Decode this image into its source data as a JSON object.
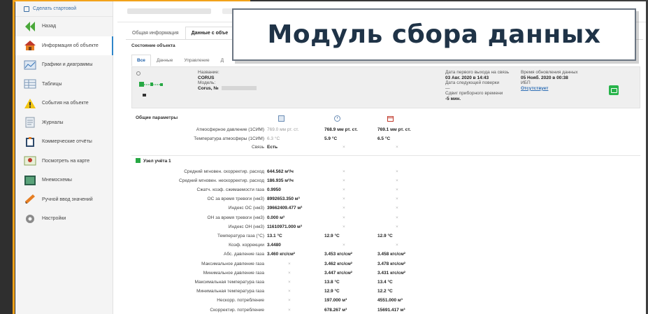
{
  "overlay_title": "Модуль сбора данных",
  "sidebar": {
    "top_link": "Сделать стартовой",
    "items": [
      {
        "label": "Назад",
        "icon": "back-arrow-icon"
      },
      {
        "label": "Информация об объекте",
        "icon": "house-icon"
      },
      {
        "label": "Графики и диаграммы",
        "icon": "chart-icon"
      },
      {
        "label": "Таблицы",
        "icon": "table-icon"
      },
      {
        "label": "События на объекте",
        "icon": "warning-icon"
      },
      {
        "label": "Журналы",
        "icon": "journal-icon"
      },
      {
        "label": "Коммерческие отчёты",
        "icon": "clipboard-icon"
      },
      {
        "label": "Посмотреть на карте",
        "icon": "map-icon"
      },
      {
        "label": "Мнемосхемы",
        "icon": "mnemo-icon"
      },
      {
        "label": "Ручной ввод значений",
        "icon": "pencil-icon"
      },
      {
        "label": "Настройки",
        "icon": "gear-icon"
      }
    ]
  },
  "tabs": [
    "Общая информация",
    "Данные с объе"
  ],
  "section_title": "Состояние объекта",
  "subtabs": [
    "Все",
    "Данные",
    "Управление",
    "Д"
  ],
  "info": {
    "name_label": "Название:",
    "name_value": "CORUS",
    "model_label": "Модель:",
    "model_value": "Corus, №",
    "first_exit_label": "Дата первого выхода на связь",
    "first_exit_value": "03 Авг. 2020 в 14:43",
    "next_check_label": "Дата следующей поверки",
    "next_check_value": "—",
    "time_shift_label": "Сдвиг приборного времени",
    "time_shift_value": "-5 мин.",
    "update_label": "Время обновления данных",
    "update_value": "05 Нояб. 2020 в 00:38",
    "ibp_label": "ИБП",
    "ibp_value": "Отсутствует"
  },
  "common_params": {
    "title": "Общие параметры",
    "rows": [
      {
        "label": "Атмосферное давление (1СИМ)",
        "v1": "769.0 мм рт. ст.",
        "v2": "768.9 мм рт. ст.",
        "v3": "769.1 мм рт. ст.",
        "v1_grey": true
      },
      {
        "label": "Температура атмосферы (1СИМ)",
        "v1": "6.3 °C",
        "v2": "5.9 °C",
        "v3": "6.5 °C",
        "v1_grey": true
      },
      {
        "label": "Связь",
        "v1": "Есть",
        "v2": "×",
        "v3": "×"
      }
    ]
  },
  "node": {
    "title": "Узел учёта 1",
    "rows": [
      {
        "label": "Средний мгновен. скорректир. расход",
        "v1": "644.562 м³/ч",
        "v2": "×",
        "v3": "×"
      },
      {
        "label": "Средний мгновен. нескорректир. расход",
        "v1": "186.935 м³/ч",
        "v2": "×",
        "v3": "×"
      },
      {
        "label": "Сжатч. коэф. сжимаемости газа",
        "v1": "0.9950",
        "v2": "×",
        "v3": "×"
      },
      {
        "label": "ОС за время тревоги (нм3)",
        "v1": "8992653.350 м³",
        "v2": "×",
        "v3": "×"
      },
      {
        "label": "Индекс ОС (нм3)",
        "v1": "39662409.477 м³",
        "v2": "×",
        "v3": "×"
      },
      {
        "label": "ОН за время тревоги (нм3)",
        "v1": "0.000 м³",
        "v2": "×",
        "v3": "×"
      },
      {
        "label": "Индекс ОН (нм3)",
        "v1": "11610971.000 м³",
        "v2": "×",
        "v3": "×"
      },
      {
        "label": "Температура газа (°C)",
        "v1": "13.1 °C",
        "v2": "12.9 °C",
        "v3": "12.9 °C"
      },
      {
        "label": "Коэф. коррекции",
        "v1": "3.4480",
        "v2": "×",
        "v3": "×"
      },
      {
        "label": "Абс. давление газа",
        "v1": "3.460 кгс/см²",
        "v2": "3.453 кгс/см²",
        "v3": "3.458 кгс/см²"
      },
      {
        "label": "Максимальное давление газа",
        "v1": "×",
        "v2": "3.462 кгс/см²",
        "v3": "3.478 кгс/см²"
      },
      {
        "label": "Минимальное давление газа",
        "v1": "×",
        "v2": "3.447 кгс/см²",
        "v3": "3.431 кгс/см²"
      },
      {
        "label": "Максимальная температура газа",
        "v1": "×",
        "v2": "13.8 °C",
        "v3": "13.4 °C"
      },
      {
        "label": "Минимальная температура газа",
        "v1": "×",
        "v2": "12.9 °C",
        "v3": "12.2 °C"
      },
      {
        "label": "Нескорр. потребление",
        "v1": "×",
        "v2": "197.000 м³",
        "v3": "4551.000 м³"
      },
      {
        "label": "Скорректир. потребление",
        "v1": "×",
        "v2": "678.267 м³",
        "v3": "15691.417 м³"
      }
    ]
  }
}
